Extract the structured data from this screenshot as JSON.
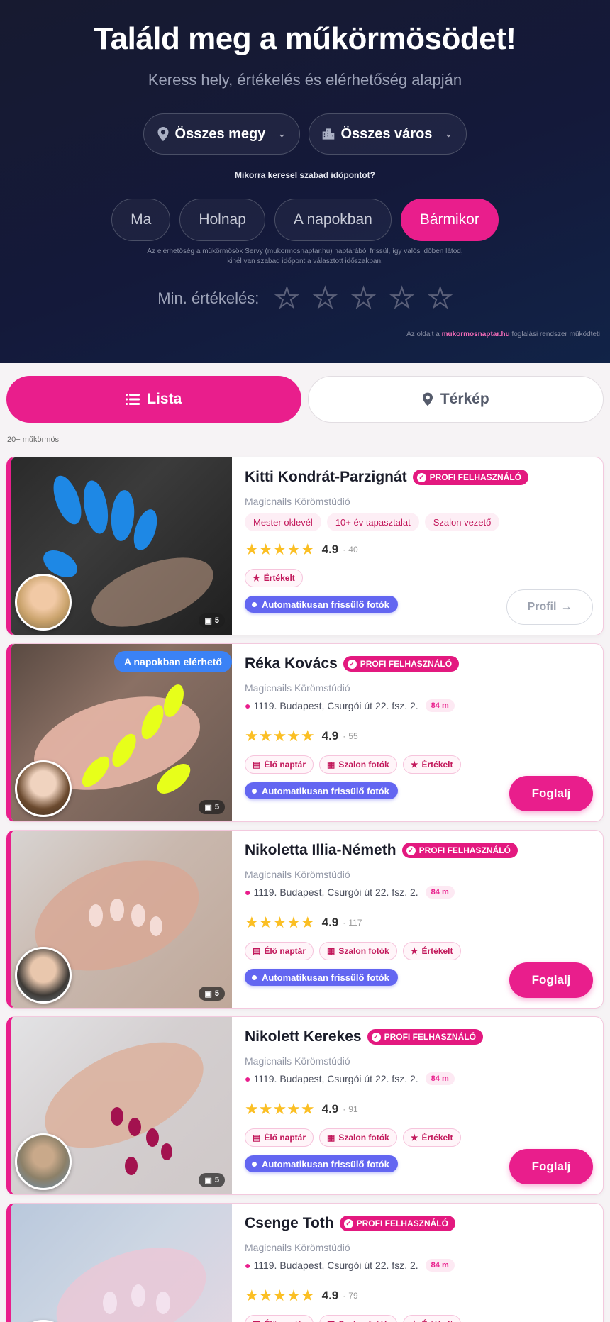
{
  "hero": {
    "title": "Találd meg a műkörmösödet!",
    "subtitle": "Keress hely, értékelés és elérhetőség alapján",
    "county_select": "Összes megy",
    "city_select": "Összes város",
    "time_question": "Mikorra keresel szabad időpontot?",
    "time_options": [
      "Ma",
      "Holnap",
      "A napokban",
      "Bármikor"
    ],
    "active_time": "Bármikor",
    "note": "Az elérhetőség a műkörmösök Servy (mukormosnaptar.hu) naptárából frissül, így valós időben látod, kinél van szabad időpont a választott időszakban.",
    "rating_label": "Min. értékelés:",
    "powered_prefix": "Az oldalt a",
    "powered_brand": "mukormosnaptar.hu",
    "powered_suffix": "foglalási rendszer működteti"
  },
  "view_toggle": {
    "list": "Lista",
    "map": "Térkép"
  },
  "result_count": "20+ műkörmös",
  "badges": {
    "profi": "PROFI FELHASZNÁLÓ",
    "auto_photos": "Automatikusan frissülő fotók",
    "book": "Foglalj",
    "profile": "Profil",
    "available_soon": "A napokban elérhető",
    "live_calendar": "Élő naptár",
    "salon_photos": "Szalon fotók",
    "reviews": "Értékelt"
  },
  "colors": {
    "accent": "#e91e8c",
    "auto_badge": "#6366f1",
    "avail_badge": "#3b82f6",
    "star": "#fbbf24"
  },
  "cards": [
    {
      "name": "Kitti Kondrát-Parzignát",
      "salon": "Magicnails Körömstúdió",
      "tags": [
        "Mester oklevél",
        "10+ év tapasztalat",
        "Szalon vezető"
      ],
      "rating": "4.9",
      "reviews": "40",
      "photos": "5"
    },
    {
      "name": "Réka Kovács",
      "salon": "Magicnails Körömstúdió",
      "address": "1119. Budapest, Csurgói út 22. fsz. 2.",
      "distance": "84 m",
      "rating": "4.9",
      "reviews": "55",
      "photos": "5"
    },
    {
      "name": "Nikoletta Illia-Németh",
      "salon": "Magicnails Körömstúdió",
      "address": "1119. Budapest, Csurgói út 22. fsz. 2.",
      "distance": "84 m",
      "rating": "4.9",
      "reviews": "117",
      "photos": "5"
    },
    {
      "name": "Nikolett Kerekes",
      "salon": "Magicnails Körömstúdió",
      "address": "1119. Budapest, Csurgói út 22. fsz. 2.",
      "distance": "84 m",
      "rating": "4.9",
      "reviews": "91",
      "photos": "5"
    },
    {
      "name": "Csenge Toth",
      "salon": "Magicnails Körömstúdió",
      "address": "1119. Budapest, Csurgói út 22. fsz. 2.",
      "distance": "84 m",
      "rating": "4.9",
      "reviews": "79"
    }
  ]
}
